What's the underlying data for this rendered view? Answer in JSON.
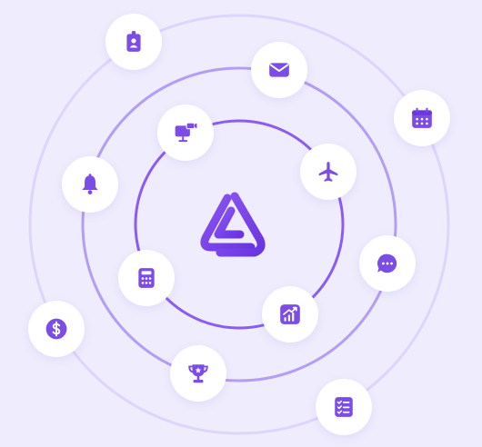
{
  "colors": {
    "background": "#efecfd",
    "ring_outer": "#ddd5fb",
    "ring_middle": "#b49df4",
    "ring_inner": "#8b5cf0",
    "icon": "#7c4ce6",
    "chip": "#ffffff"
  },
  "center": {
    "icon": "triangle-logo-icon"
  },
  "nodes": [
    {
      "id": "badge",
      "icon": "id-badge-icon",
      "ring": "outer"
    },
    {
      "id": "mail",
      "icon": "envelope-icon",
      "ring": "middle"
    },
    {
      "id": "calendar",
      "icon": "calendar-icon",
      "ring": "outer"
    },
    {
      "id": "presentation",
      "icon": "presentation-video-icon",
      "ring": "inner"
    },
    {
      "id": "airplane",
      "icon": "airplane-icon",
      "ring": "inner"
    },
    {
      "id": "bell",
      "icon": "bell-icon",
      "ring": "middle"
    },
    {
      "id": "chat",
      "icon": "chat-bubble-icon",
      "ring": "middle"
    },
    {
      "id": "calculator",
      "icon": "calculator-icon",
      "ring": "inner"
    },
    {
      "id": "chart",
      "icon": "growth-chart-icon",
      "ring": "inner"
    },
    {
      "id": "dollar",
      "icon": "dollar-coin-icon",
      "ring": "outer"
    },
    {
      "id": "trophy",
      "icon": "trophy-icon",
      "ring": "middle"
    },
    {
      "id": "checklist",
      "icon": "checklist-icon",
      "ring": "outer"
    }
  ]
}
